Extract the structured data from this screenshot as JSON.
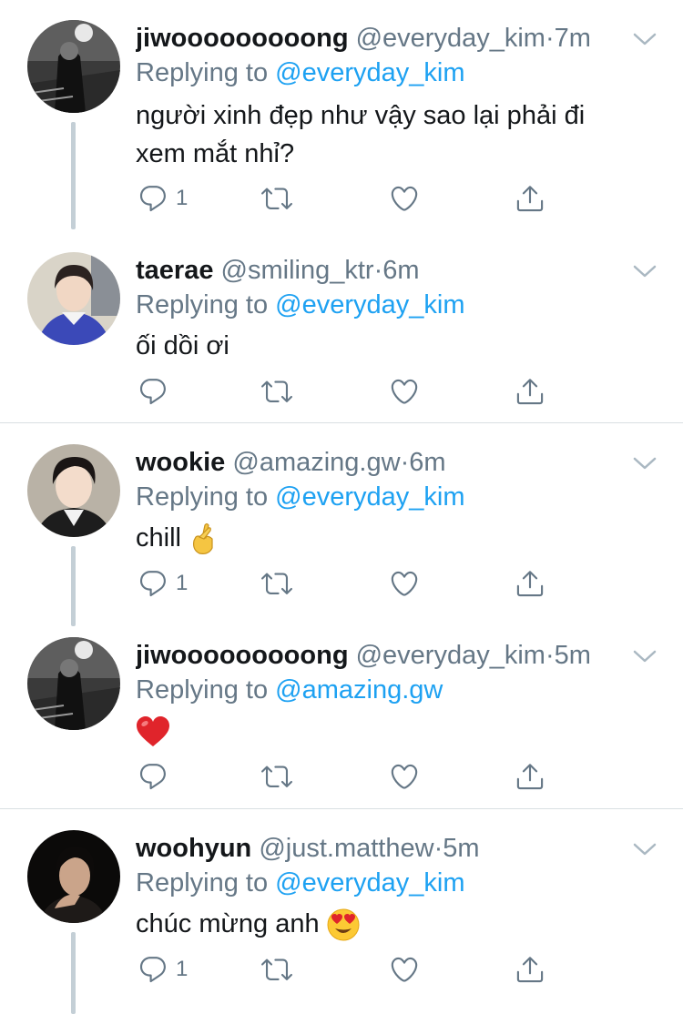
{
  "tweets": [
    {
      "name": "jiwooooooooong",
      "handle": "@everyday_kim",
      "time": "7m",
      "replying_label": "Replying to",
      "replying_to": "@everyday_kim",
      "text_lines": [
        "người xinh đẹp như vậy sao lại phải đi",
        "xem mắt nhỉ?"
      ],
      "reply_count": "1",
      "avatar": "grayscale-person-photo"
    },
    {
      "name": "taerae",
      "handle": "@smiling_ktr",
      "time": "6m",
      "replying_label": "Replying to",
      "replying_to": "@everyday_kim",
      "text": "ối dồi ơi",
      "reply_count": "",
      "avatar": "person-blue-sweater-photo"
    },
    {
      "name": "wookie",
      "handle": "@amazing.gw",
      "time": "6m",
      "replying_label": "Replying to",
      "replying_to": "@everyday_kim",
      "text": "chill",
      "emoji": "crossed-fingers-emoji",
      "reply_count": "1",
      "avatar": "person-photo"
    },
    {
      "name": "jiwooooooooong",
      "handle": "@everyday_kim",
      "time": "5m",
      "replying_label": "Replying to",
      "replying_to": "@amazing.gw",
      "emoji": "red-heart-emoji",
      "reply_count": "",
      "avatar": "grayscale-person-photo"
    },
    {
      "name": "woohyun",
      "handle": "@just.matthew",
      "time": "5m",
      "replying_label": "Replying to",
      "replying_to": "@everyday_kim",
      "text": "chúc mừng anh",
      "emoji": "heart-eyes-emoji",
      "reply_count": "1",
      "avatar": "dark-portrait-photo"
    }
  ],
  "separator": "·",
  "colors": {
    "link": "#1da1f2",
    "muted": "#657786",
    "text": "#14171a",
    "divider": "#d9dfe3",
    "thread_line": "#c4cfd6"
  }
}
